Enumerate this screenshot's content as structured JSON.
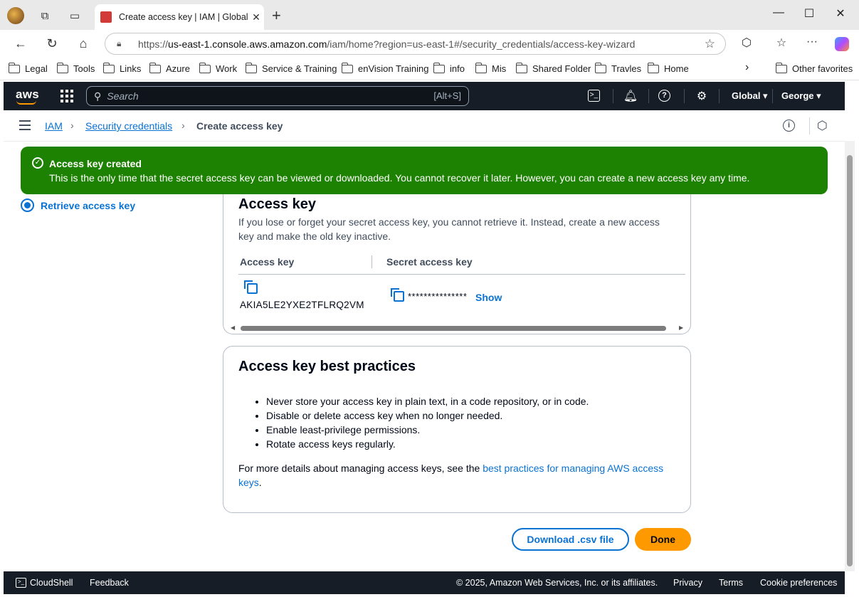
{
  "browser": {
    "tab_title": "Create access key | IAM | Global",
    "url_prefix": "https://",
    "url_domain": "us-east-1.console.aws.amazon.com",
    "url_path": "/iam/home?region=us-east-1#/security_credentials/access-key-wizard",
    "bookmarks": [
      "Legal",
      "Tools",
      "Links",
      "Azure",
      "Work",
      "Service & Training",
      "enVision Training",
      "info",
      "Mis",
      "Shared Folder",
      "Travles",
      "Home"
    ],
    "other_favorites": "Other favorites"
  },
  "aws_header": {
    "logo": "aws",
    "search_placeholder": "Search",
    "search_hotkey": "[Alt+S]",
    "region": "Global ▾",
    "user": "George ▾"
  },
  "breadcrumb": {
    "items": [
      "IAM",
      "Security credentials"
    ],
    "current": "Create access key"
  },
  "flash": {
    "title": "Access key created",
    "message": "This is the only time that the secret access key can be viewed or downloaded. You cannot recover it later. However, you can create a new access key any time."
  },
  "steps": {
    "current_label": "Retrieve access key"
  },
  "access_key_card": {
    "title": "Access key",
    "description": "If you lose or forget your secret access key, you cannot retrieve it. Instead, create a new access key and make the old key inactive.",
    "col_access_key": "Access key",
    "col_secret_key": "Secret access key",
    "access_key_value": "AKIA5LE2YXE2TFLRQ2VM",
    "secret_masked": "***************",
    "show_label": "Show"
  },
  "best_practices": {
    "title": "Access key best practices",
    "items": [
      "Never store your access key in plain text, in a code repository, or in code.",
      "Disable or delete access key when no longer needed.",
      "Enable least-privilege permissions.",
      "Rotate access keys regularly."
    ],
    "more_prefix": "For more details about managing access keys, see the ",
    "more_link": "best practices for managing AWS access keys",
    "more_suffix": "."
  },
  "actions": {
    "download": "Download .csv file",
    "done": "Done"
  },
  "footer": {
    "cloudshell": "CloudShell",
    "feedback": "Feedback",
    "copyright": "© 2025, Amazon Web Services, Inc. or its affiliates.",
    "privacy": "Privacy",
    "terms": "Terms",
    "cookies": "Cookie preferences"
  },
  "colors": {
    "success": "#1d8102",
    "link": "#0972d3",
    "primary_button": "#ff9900",
    "header_bg": "#161d26"
  }
}
